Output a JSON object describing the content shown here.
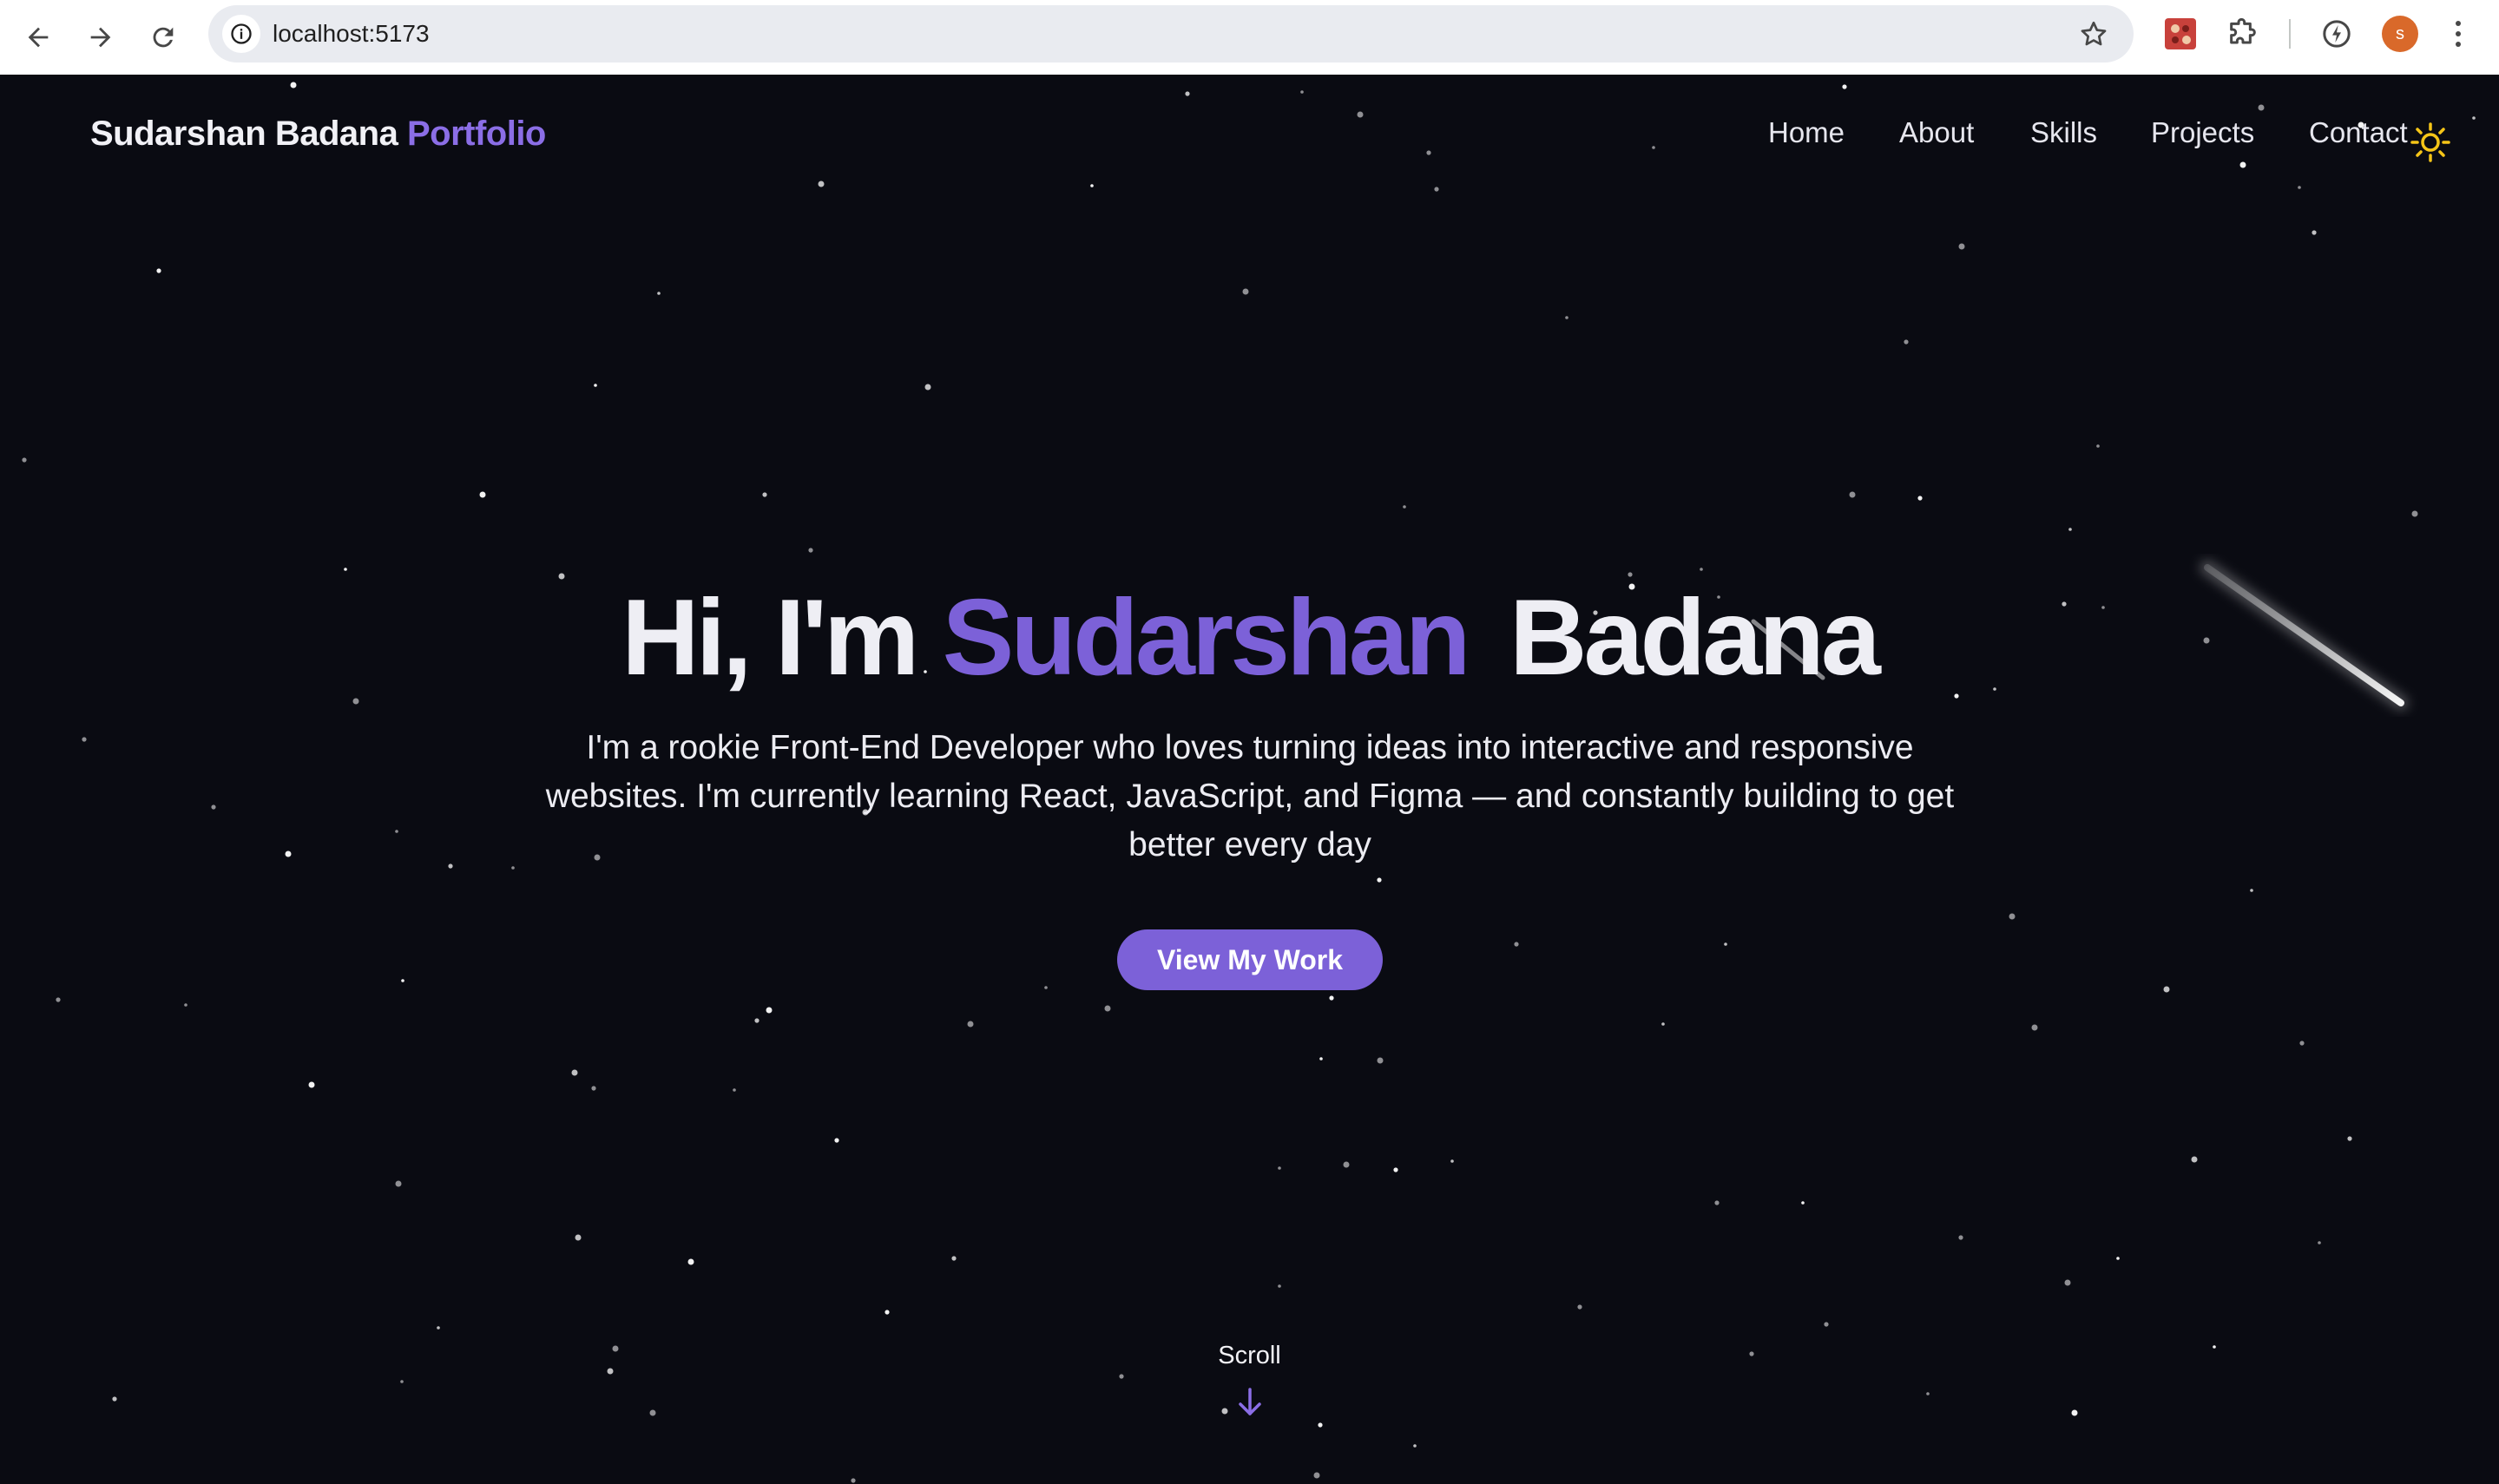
{
  "browser": {
    "url": "localhost:5173",
    "profile_initial": "s",
    "icons": {
      "back": "arrow-left-icon",
      "forward": "arrow-right-icon",
      "reload": "reload-icon",
      "site_info": "info-icon",
      "bookmark": "star-icon",
      "extensions": "puzzle-icon",
      "menu": "kebab-icon"
    }
  },
  "header": {
    "brand_name": "Sudarshan Badana",
    "brand_accent": "Portfolio",
    "nav": [
      {
        "label": "Home"
      },
      {
        "label": "About"
      },
      {
        "label": "Skills"
      },
      {
        "label": "Projects"
      },
      {
        "label": "Contact"
      }
    ],
    "theme_icon": "sun-icon"
  },
  "hero": {
    "greeting": "Hi, I'm",
    "first_name": "Sudarshan",
    "last_name": "Badana",
    "description": "I'm a rookie Front-End Developer who loves turning ideas into interactive and responsive websites. I'm currently learning React, JavaScript, and Figma — and constantly building to get better every day",
    "cta_label": "View My Work"
  },
  "scroll": {
    "label": "Scroll",
    "icon": "arrow-down-icon"
  },
  "colors": {
    "background": "#0a0b12",
    "accent": "#7c61d8",
    "text": "#eeeef4",
    "sun": "#f5c518"
  }
}
